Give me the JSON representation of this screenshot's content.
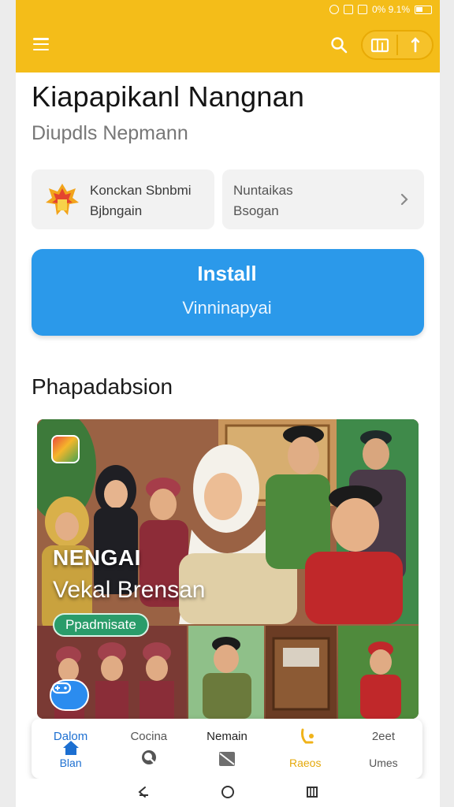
{
  "status_bar": {
    "text": "0% 9.1%"
  },
  "header": {
    "menu_icon": "hamburger-menu-icon",
    "search_icon": "search-icon",
    "action_icons": [
      "gallery-icon",
      "share-icon"
    ],
    "background_color": "#f4bd19"
  },
  "app": {
    "title": "Kiapapikanl Nangnan",
    "subtitle": "Diupdls Nepmann"
  },
  "info_cards": [
    {
      "line1": "Konckan Sbnbmi",
      "line2": "Bjbngain",
      "icon": "logo-icon"
    },
    {
      "line1": "Nuntaikas",
      "line2": "Bsogan",
      "icon": "chevron-right-icon"
    }
  ],
  "install": {
    "label": "Install",
    "sub_label": "Vinninapyai",
    "color": "#2b99ea"
  },
  "section": {
    "title": "Phapadabsion"
  },
  "hero": {
    "headline": "NENGAI",
    "subheadline": "Vekal Brensan",
    "badge": "Ppadmisate",
    "badge_color": "#2a9c6a",
    "fab_icon": "game-controller-icon"
  },
  "bottom_nav": [
    {
      "top": "Dalom",
      "bottom": "Blan",
      "icon": "home-icon"
    },
    {
      "top": "Cocina",
      "bottom": "",
      "icon": "search-icon"
    },
    {
      "top": "Nemain",
      "bottom": "",
      "icon": "mail-icon"
    },
    {
      "top": "",
      "bottom": "Raeos",
      "icon": "rocket-icon"
    },
    {
      "top": "2eet",
      "bottom": "Umes",
      "icon": ""
    }
  ],
  "system_nav": {
    "icons": [
      "back-icon",
      "home-circle-icon",
      "recents-icon"
    ]
  }
}
